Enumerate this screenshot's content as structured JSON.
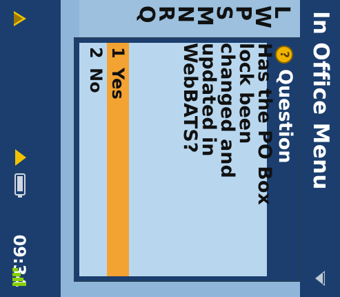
{
  "app": {
    "title": "In Office Menu",
    "time": "09:34"
  },
  "index_letters": [
    "L",
    "W",
    "P",
    "S",
    "M",
    "N",
    "R",
    "Q"
  ],
  "dialog": {
    "title": "Question",
    "question": "Has the PO Box lock been changed and updated in WebBATS?",
    "options": [
      {
        "num": "1",
        "label": "Yes",
        "selected": true
      },
      {
        "num": "2",
        "label": "No",
        "selected": false
      }
    ]
  },
  "icons": {
    "question": "question-mark-icon",
    "signal": "signal-icon",
    "battery": "battery-icon",
    "alert": "alert-icon",
    "menu": "menu-icon"
  },
  "colors": {
    "header": "#1b3e6e",
    "selection": "#f2a332",
    "panel": "#b8d7ef"
  }
}
